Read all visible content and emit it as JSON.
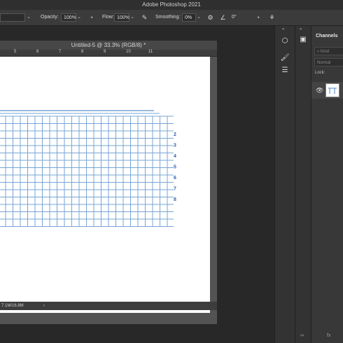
{
  "app": {
    "title": "Adobe Photoshop 2021"
  },
  "options_bar": {
    "opacity_label": "Opacity:",
    "opacity_value": "100%",
    "flow_label": "Flow:",
    "flow_value": "100%",
    "smoothing_label": "Smoothing:",
    "smoothing_value": "0%",
    "angle_value": "0°",
    "icons": [
      "pressure-opacity-icon",
      "airbrush-icon",
      "smoothing-settings-icon",
      "angle-icon",
      "pressure-size-icon",
      "symmetry-icon"
    ]
  },
  "document": {
    "tab_title": "Untitled-5 @ 33.3% (RGB/8) *",
    "ruler_ticks": [
      "5",
      "6",
      "7",
      "8",
      "9",
      "10",
      "11"
    ],
    "status_text": "7.1M/16.8M",
    "status_arrow": "›",
    "canvas_numbers": [
      "2",
      "3",
      "4",
      "5",
      "6",
      "7",
      "8"
    ],
    "grid_color": "#4a86c8"
  },
  "tools": [
    "3d-icon",
    "brush-settings-icon",
    "adjustments-icon"
  ],
  "panel": {
    "tab_label": "Channels",
    "kind_placeholder": "Kind",
    "blend_mode": "Normal",
    "lock_label": "Lock:",
    "footer_text": "fx"
  }
}
